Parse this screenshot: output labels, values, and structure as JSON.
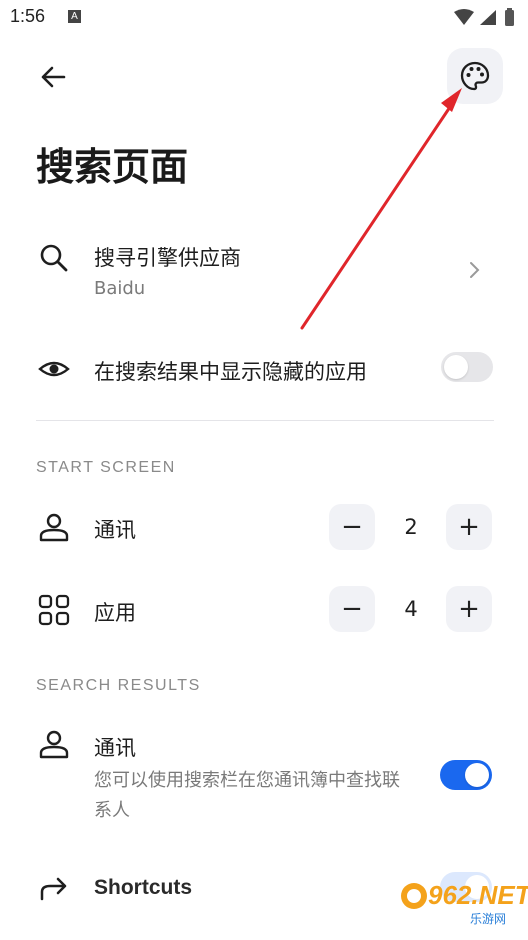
{
  "status_bar": {
    "time": "1:56",
    "notification_letter": "A"
  },
  "header": {
    "title": "搜索页面"
  },
  "search_provider": {
    "label": "搜寻引擎供应商",
    "value": "Baidu"
  },
  "show_hidden": {
    "label": "在搜索结果中显示隐藏的应用",
    "enabled": false
  },
  "start_screen": {
    "header": "START SCREEN",
    "contacts": {
      "label": "通讯",
      "count": "2",
      "minus": "−",
      "plus": "+"
    },
    "apps": {
      "label": "应用",
      "count": "4",
      "minus": "−",
      "plus": "+"
    }
  },
  "search_results": {
    "header": "SEARCH RESULTS",
    "contacts": {
      "label": "通讯",
      "description": "您可以使用搜索栏在您通讯簿中查找联系人",
      "enabled": true
    },
    "shortcuts": {
      "label": "Shortcuts",
      "enabled": true
    }
  },
  "watermark": {
    "brand": "962.NET",
    "sub": "乐游网"
  },
  "colors": {
    "accent": "#1a68ef",
    "annotation_arrow": "#e0262b",
    "surface": "#f1f2f6"
  }
}
